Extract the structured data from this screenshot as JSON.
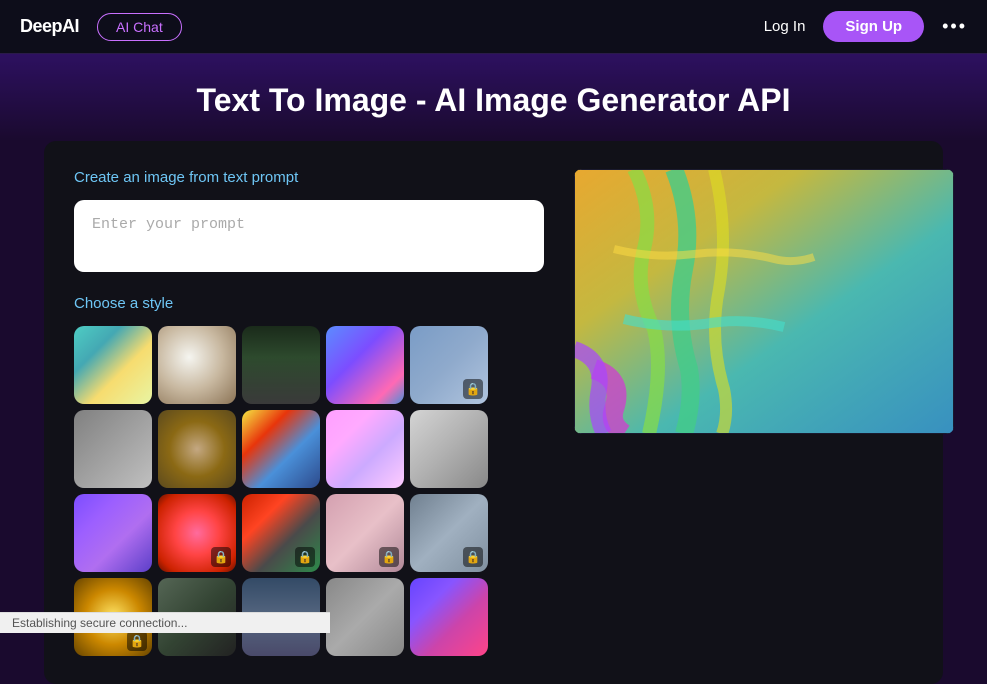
{
  "nav": {
    "logo": "DeepAI",
    "ai_chat_label": "AI Chat",
    "login_label": "Log In",
    "signup_label": "Sign Up",
    "more_icon": "•••"
  },
  "header": {
    "title": "Text To Image - AI Image Generator API"
  },
  "main": {
    "create_label": "Create an image from text prompt",
    "prompt_placeholder": "Enter your prompt",
    "choose_style_label": "Choose a style",
    "styles": [
      {
        "id": 1,
        "locked": false
      },
      {
        "id": 2,
        "locked": false
      },
      {
        "id": 3,
        "locked": false
      },
      {
        "id": 4,
        "locked": false
      },
      {
        "id": 5,
        "locked": true
      },
      {
        "id": 6,
        "locked": false
      },
      {
        "id": 7,
        "locked": false
      },
      {
        "id": 8,
        "locked": false
      },
      {
        "id": 9,
        "locked": false
      },
      {
        "id": 10,
        "locked": false
      },
      {
        "id": 11,
        "locked": false
      },
      {
        "id": 12,
        "locked": true
      },
      {
        "id": 13,
        "locked": true
      },
      {
        "id": 14,
        "locked": true
      },
      {
        "id": 15,
        "locked": true
      },
      {
        "id": 16,
        "locked": true
      },
      {
        "id": 17,
        "locked": false
      },
      {
        "id": 18,
        "locked": false
      },
      {
        "id": 19,
        "locked": false
      },
      {
        "id": 20,
        "locked": false
      }
    ]
  },
  "status": {
    "text": "Establishing secure connection..."
  }
}
